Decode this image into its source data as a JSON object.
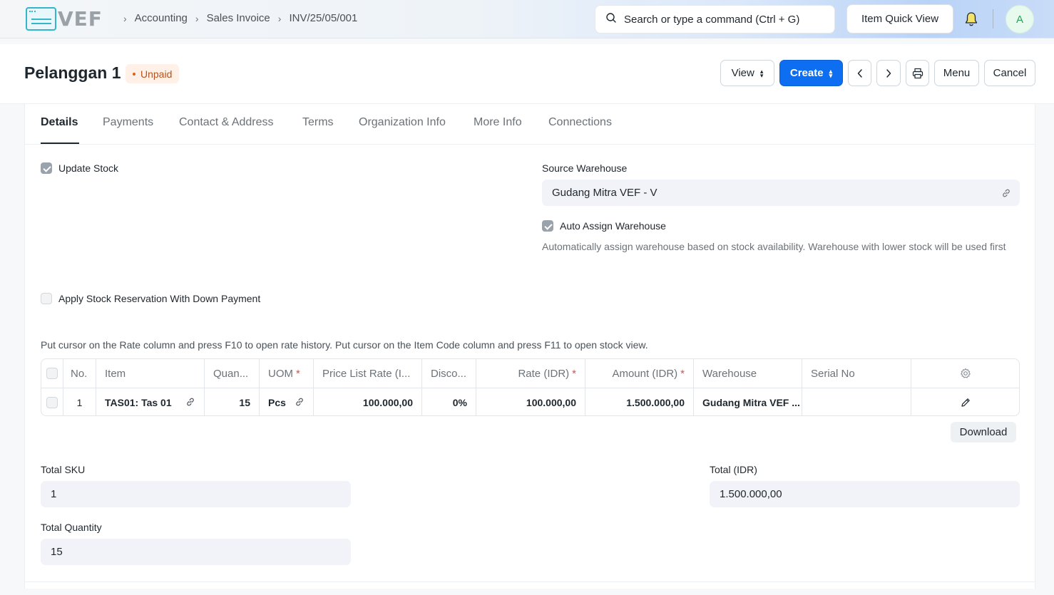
{
  "app": {
    "logo_text": "VEF"
  },
  "breadcrumbs": [
    "Accounting",
    "Sales Invoice",
    "INV/25/05/001"
  ],
  "search": {
    "placeholder": "Search or type a command (Ctrl + G)"
  },
  "navbar": {
    "quick_view_label": "Item Quick View",
    "avatar_initial": "A"
  },
  "page": {
    "title": "Pelanggan 1",
    "status": "Unpaid",
    "status_color": "#d9601d",
    "accent_color": "#0e6ef2",
    "buttons": {
      "view": "View",
      "create": "Create",
      "menu": "Menu",
      "cancel": "Cancel"
    }
  },
  "tabs": [
    "Details",
    "Payments",
    "Contact & Address",
    "Terms",
    "Organization Info",
    "More Info",
    "Connections"
  ],
  "details": {
    "update_stock_label": "Update Stock",
    "update_stock_checked": true,
    "source_warehouse_label": "Source Warehouse",
    "source_warehouse_value": "Gudang Mitra VEF - V",
    "auto_assign_label": "Auto Assign Warehouse",
    "auto_assign_checked": true,
    "auto_assign_help": "Automatically assign warehouse based on stock availability. Warehouse with lower stock will be used first",
    "reservation_label": "Apply Stock Reservation With Down Payment",
    "reservation_checked": false,
    "grid_hint": "Put cursor on the Rate column and press F10 to open rate history. Put cursor on the Item Code column and press F11 to open stock view."
  },
  "items_table": {
    "headers": {
      "no": "No.",
      "item": "Item",
      "qty": "Quan...",
      "uom": "UOM",
      "price_list_rate": "Price List Rate (I...",
      "discount": "Disco...",
      "rate": "Rate (IDR)",
      "amount": "Amount (IDR)",
      "warehouse": "Warehouse",
      "serial_no": "Serial No"
    },
    "rows": [
      {
        "no": "1",
        "item": "TAS01: Tas 01",
        "qty": "15",
        "uom": "Pcs",
        "price_list_rate": "100.000,00",
        "discount": "0%",
        "rate": "100.000,00",
        "amount": "1.500.000,00",
        "warehouse": "Gudang Mitra VEF ...",
        "serial_no": ""
      }
    ],
    "download_label": "Download"
  },
  "totals": {
    "total_sku_label": "Total SKU",
    "total_sku": "1",
    "total_qty_label": "Total Quantity",
    "total_qty": "15",
    "total_label": "Total (IDR)",
    "total": "1.500.000,00"
  }
}
